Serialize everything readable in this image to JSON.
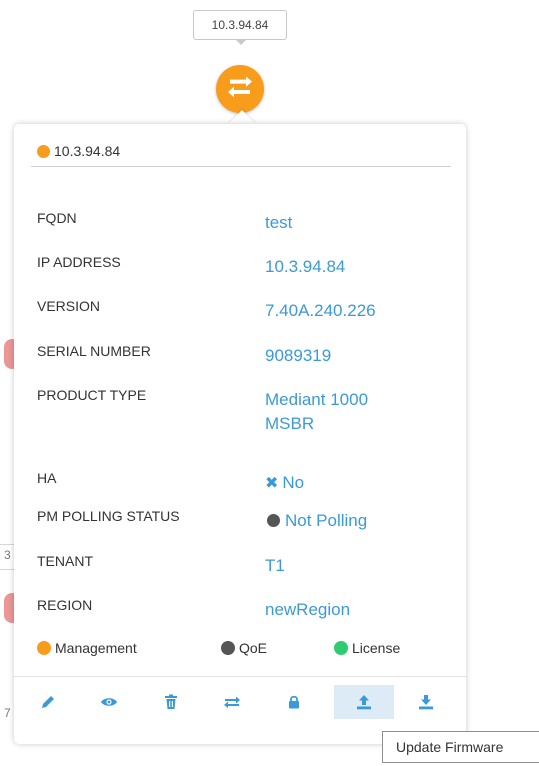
{
  "node": {
    "label": "10.3.94.84",
    "color": "#f89c1c",
    "icon": "exchange-arrows-icon"
  },
  "popup": {
    "title": "10.3.94.84",
    "status_color": "#f89c1c",
    "fields": {
      "fqdn": {
        "label": "FQDN",
        "value": "test"
      },
      "ip_address": {
        "label": "IP ADDRESS",
        "value": "10.3.94.84"
      },
      "version": {
        "label": "VERSION",
        "value": "7.40A.240.226"
      },
      "serial_number": {
        "label": "SERIAL NUMBER",
        "value": "9089319"
      },
      "product_type": {
        "label": "PRODUCT TYPE",
        "value_line1": "Mediant 1000",
        "value_line2": "MSBR"
      },
      "ha": {
        "label": "HA",
        "value": "No",
        "icon": "x-icon"
      },
      "pm_polling_status": {
        "label": "PM POLLING STATUS",
        "value": "Not Polling",
        "icon": "status-dot-icon"
      },
      "tenant": {
        "label": "TENANT",
        "value": "T1"
      },
      "region": {
        "label": "REGION",
        "value": "newRegion"
      }
    },
    "legend": [
      {
        "label": "Management",
        "color": "#f89c1c"
      },
      {
        "label": "QoE",
        "color": "#555555"
      },
      {
        "label": "License",
        "color": "#2ecc71"
      }
    ],
    "toolbar": [
      {
        "name": "edit",
        "icon": "pencil-icon"
      },
      {
        "name": "view",
        "icon": "eye-icon"
      },
      {
        "name": "delete",
        "icon": "trash-icon"
      },
      {
        "name": "move",
        "icon": "swap-arrows-icon"
      },
      {
        "name": "lock",
        "icon": "lock-icon"
      },
      {
        "name": "update-firmware",
        "icon": "upload-icon",
        "active": true
      },
      {
        "name": "download",
        "icon": "download-icon"
      }
    ],
    "accent_color": "#3a9ad9"
  },
  "tooltip": {
    "text": "Update Firmware"
  },
  "background_fragments": [
    "3",
    "7"
  ]
}
